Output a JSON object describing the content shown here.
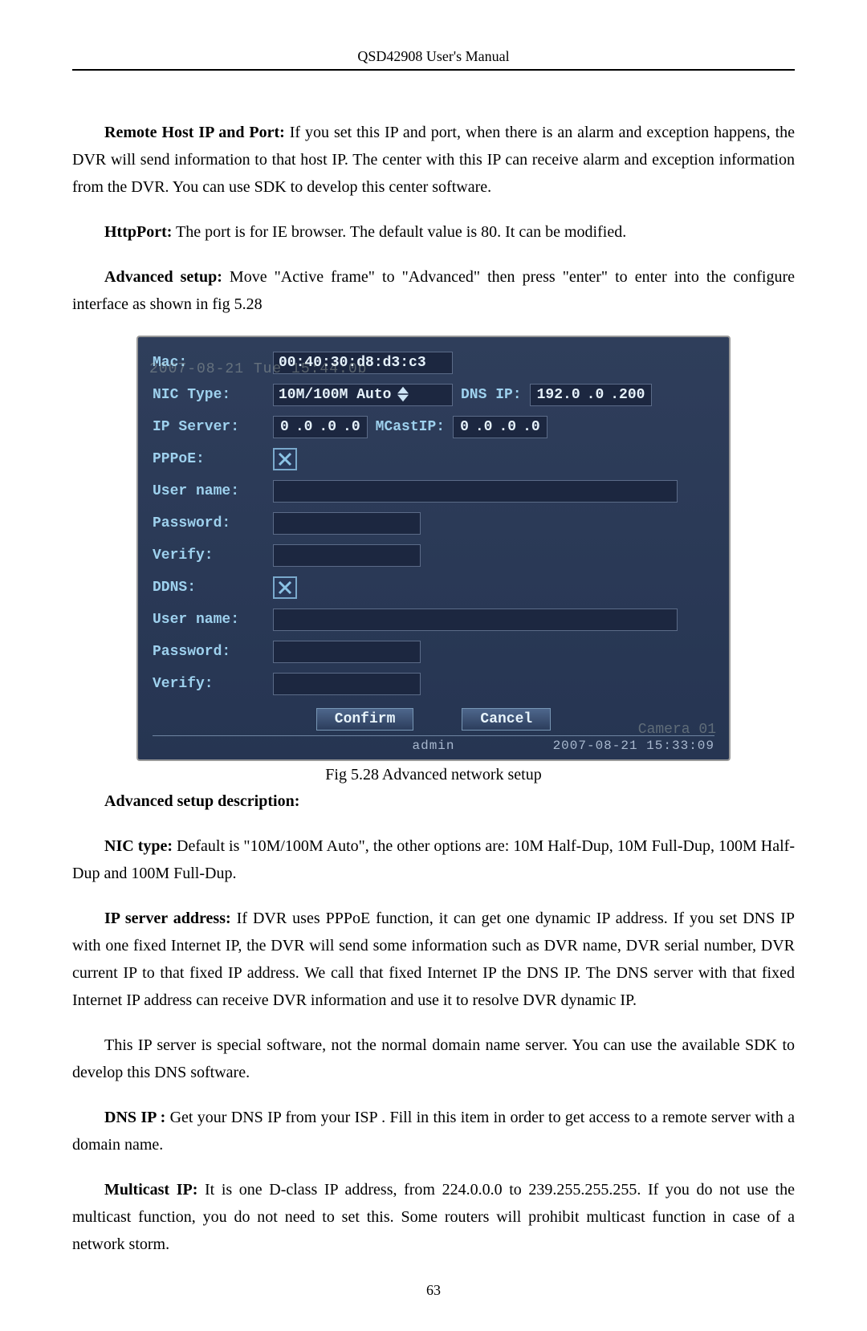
{
  "header": "QSD42908 User's Manual",
  "page_number": "63",
  "p1_lead": "Remote Host IP and Port:",
  "p1_rest": " If you set this IP and port, when there is an alarm and exception happens, the DVR will send information to that host IP. The center with this IP can receive alarm and exception information from the DVR. You can use SDK to develop this center software.",
  "p2_lead": "HttpPort:",
  "p2_rest": " The port is for IE browser. The default value is 80. It can be modified.",
  "p3_lead": "Advanced setup:",
  "p3_rest": " Move \"Active frame\" to \"Advanced\" then press \"enter\" to enter into the configure interface as shown in fig 5.28",
  "fig_caption": "Fig 5.28 Advanced network setup",
  "p4": "Advanced setup description:",
  "p5_lead": "NIC type:",
  "p5_rest": " Default is \"10M/100M Auto\", the other options are: 10M Half-Dup, 10M Full-Dup, 100M Half-Dup and 100M Full-Dup.",
  "p6_lead": "IP server address:",
  "p6_rest": " If DVR uses PPPoE function, it can get one dynamic IP address. If you set DNS IP  with one fixed Internet IP, the DVR will send some information such as DVR name, DVR serial number, DVR current IP to that fixed IP address. We call that fixed Internet IP the DNS IP.  The DNS server with that fixed Internet IP address can receive DVR information and use it to resolve DVR dynamic IP.",
  "p7": "This IP server is special software, not the normal domain name server. You can use the available SDK to develop this DNS software.",
  "p8_lead": "DNS IP :",
  "p8_rest": " Get your DNS IP from your ISP . Fill in this item in order to get access to a remote server with a domain name.",
  "p9_lead": "Multicast IP:",
  "p9_rest": " It is one D-class IP address, from 224.0.0.0 to 239.255.255.255. If you do not use the multicast function, you do not need to set this. Some routers will prohibit multicast function in case of a network storm.",
  "ui": {
    "mac_label": "Mac:",
    "mac_value": "00:40:30:d8:d3:c3",
    "nic_label": "NIC Type:",
    "nic_value": "10M/100M Auto",
    "dns_label": "DNS IP:",
    "dns_ip": [
      "192.0",
      ".0",
      ".200"
    ],
    "ipserver_label": "IP Server:",
    "ipserver_ip": [
      "0",
      ".0",
      ".0",
      ".0"
    ],
    "mcast_label": "MCastIP:",
    "mcast_ip": [
      "0",
      ".0",
      ".0",
      ".0"
    ],
    "pppoe_label": "PPPoE:",
    "user_label": "User name:",
    "pass_label": "Password:",
    "verify_label": "Verify:",
    "ddns_label": "DDNS:",
    "confirm": "Confirm",
    "cancel": "Cancel",
    "status_user": "admin",
    "status_time": "2007-08-21 15:33:09",
    "overlay_tl": "2007-08-21  Tue  15:44:0b",
    "overlay_br": "Camera 01"
  }
}
